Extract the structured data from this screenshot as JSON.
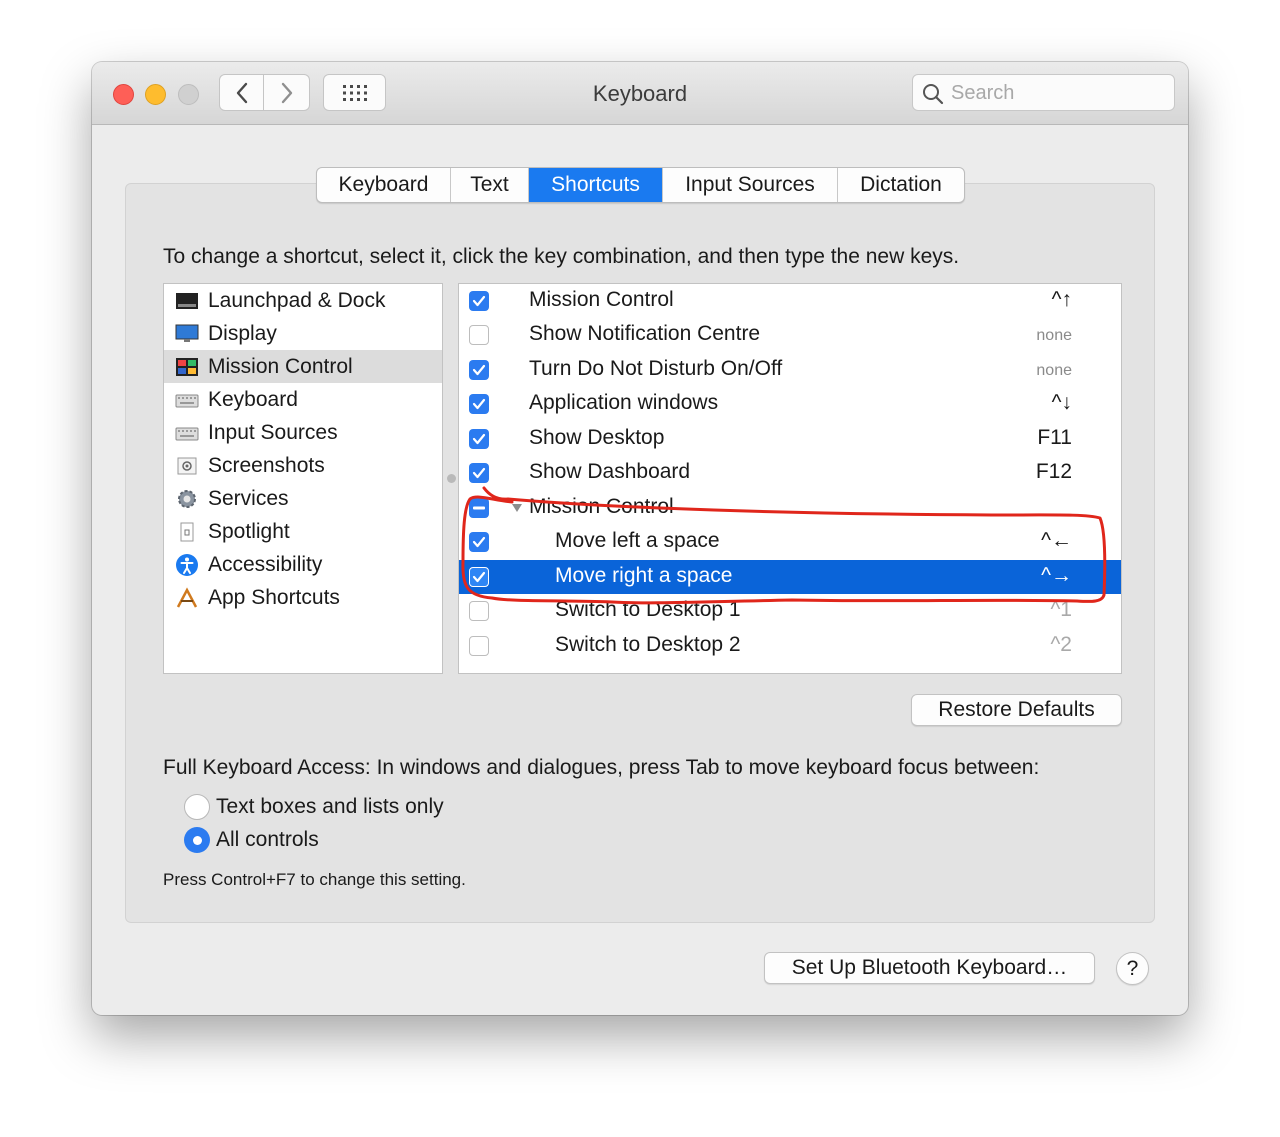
{
  "window": {
    "title": "Keyboard"
  },
  "search": {
    "placeholder": "Search"
  },
  "tabs": [
    {
      "label": "Keyboard",
      "active": false
    },
    {
      "label": "Text",
      "active": false
    },
    {
      "label": "Shortcuts",
      "active": true
    },
    {
      "label": "Input Sources",
      "active": false
    },
    {
      "label": "Dictation",
      "active": false
    }
  ],
  "instruction": "To change a shortcut, select it, click the key combination, and then type the new keys.",
  "categories": [
    {
      "label": "Launchpad & Dock",
      "icon": "launchpad-dock-icon"
    },
    {
      "label": "Display",
      "icon": "display-icon"
    },
    {
      "label": "Mission Control",
      "icon": "mission-control-icon",
      "selected": true
    },
    {
      "label": "Keyboard",
      "icon": "keyboard-icon"
    },
    {
      "label": "Input Sources",
      "icon": "input-sources-icon"
    },
    {
      "label": "Screenshots",
      "icon": "screenshots-icon"
    },
    {
      "label": "Services",
      "icon": "gear-icon"
    },
    {
      "label": "Spotlight",
      "icon": "spotlight-icon"
    },
    {
      "label": "Accessibility",
      "icon": "accessibility-icon"
    },
    {
      "label": "App Shortcuts",
      "icon": "app-shortcuts-icon"
    }
  ],
  "shortcuts": [
    {
      "label": "Mission Control",
      "keys": "^↑",
      "state": "on",
      "level": 1
    },
    {
      "label": "Show Notification Centre",
      "keys": "none",
      "state": "off",
      "level": 1
    },
    {
      "label": "Turn Do Not Disturb On/Off",
      "keys": "none",
      "state": "on",
      "level": 1
    },
    {
      "label": "Application windows",
      "keys": "^↓",
      "state": "on",
      "level": 1
    },
    {
      "label": "Show Desktop",
      "keys": "F11",
      "state": "on",
      "level": 1
    },
    {
      "label": "Show Dashboard",
      "keys": "F12",
      "state": "on",
      "level": 1
    },
    {
      "label": "Mission Control",
      "keys": "",
      "state": "mixed",
      "level": 1,
      "group": true
    },
    {
      "label": "Move left a space",
      "keys": "^←",
      "state": "on",
      "level": 2
    },
    {
      "label": "Move right a space",
      "keys": "^→",
      "state": "on",
      "level": 2,
      "selected": true
    },
    {
      "label": "Switch to Desktop 1",
      "keys": "^1",
      "state": "off",
      "level": 2
    },
    {
      "label": "Switch to Desktop 2",
      "keys": "^2",
      "state": "off",
      "level": 2
    }
  ],
  "restore_label": "Restore Defaults",
  "full_keyboard_access": {
    "label": "Full Keyboard Access: In windows and dialogues, press Tab to move keyboard focus between:",
    "options": [
      {
        "label": "Text boxes and lists only",
        "selected": false
      },
      {
        "label": "All controls",
        "selected": true
      }
    ],
    "hint": "Press Control+F7 to change this setting."
  },
  "bluetooth_label": "Set Up Bluetooth Keyboard…",
  "help_label": "?",
  "colors": {
    "accent": "#1a7af0",
    "annotation": "#e0261b",
    "selection": "#0a64d9"
  }
}
